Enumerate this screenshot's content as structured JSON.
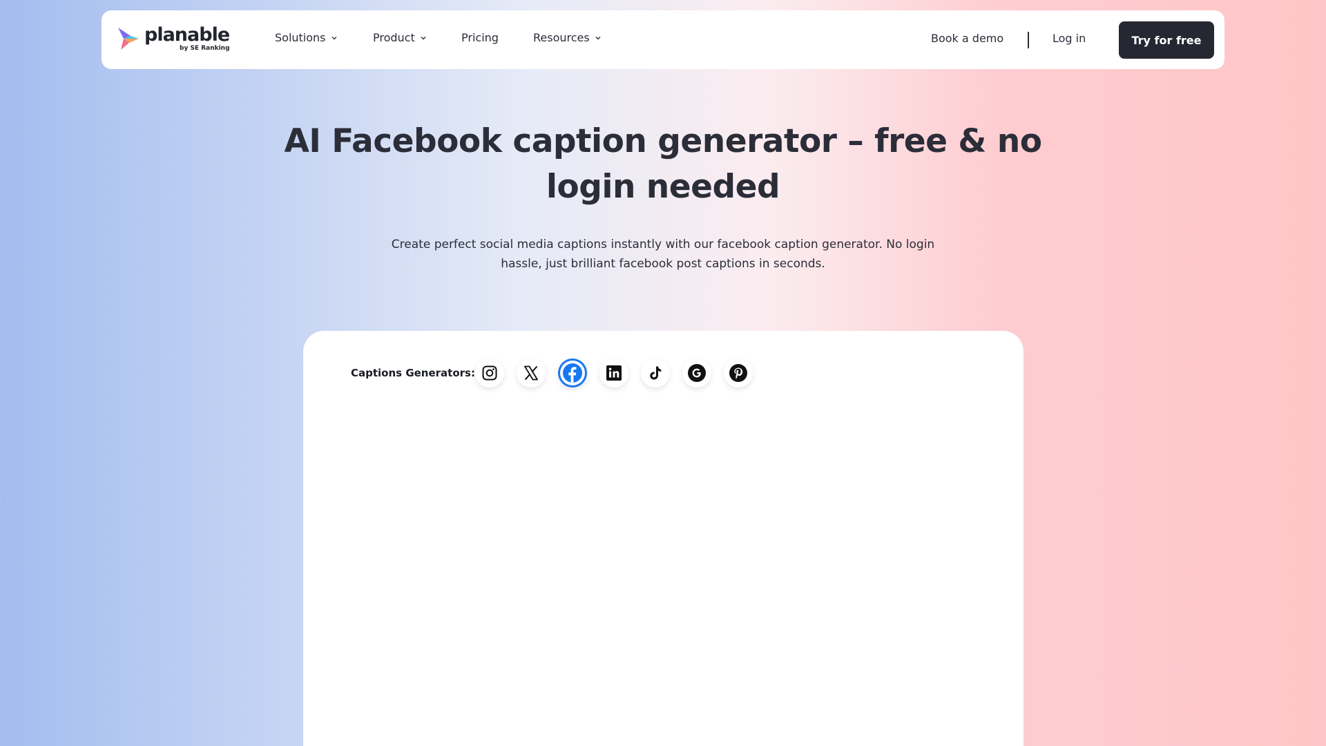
{
  "nav": {
    "logo_text": "planable",
    "logo_sub": "by SE Ranking",
    "items": [
      {
        "label": "Solutions",
        "has_dropdown": true
      },
      {
        "label": "Product",
        "has_dropdown": true
      },
      {
        "label": "Pricing",
        "has_dropdown": false
      },
      {
        "label": "Resources",
        "has_dropdown": true
      }
    ],
    "book_demo": "Book a demo",
    "login": "Log in",
    "cta": "Try for free"
  },
  "hero": {
    "title": "AI Facebook caption generator – free & no login needed",
    "subtitle": "Create perfect social media captions instantly with our facebook caption generator. No login hassle, just brilliant facebook post captions in seconds."
  },
  "generator": {
    "label": "Captions Generators:",
    "platforms": [
      {
        "icon": "instagram-icon",
        "selected": false
      },
      {
        "icon": "x-icon",
        "selected": false
      },
      {
        "icon": "facebook-icon",
        "selected": true
      },
      {
        "icon": "linkedin-icon",
        "selected": false
      },
      {
        "icon": "tiktok-icon",
        "selected": false
      },
      {
        "icon": "google-icon",
        "selected": false
      },
      {
        "icon": "pinterest-icon",
        "selected": false
      }
    ]
  },
  "colors": {
    "dark": "#252833",
    "text": "#2b2d38",
    "facebook_blue": "#1877f2",
    "bg_left": "#a3bdef",
    "bg_right": "#ffc6c7"
  }
}
